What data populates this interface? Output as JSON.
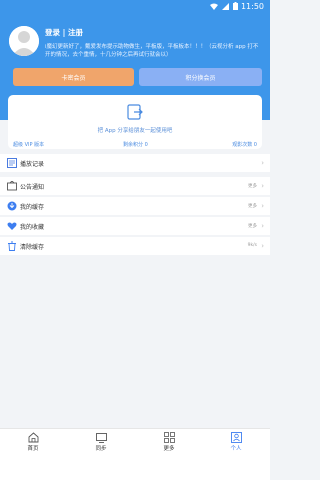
{
  "status_bar": {
    "time": "11:50"
  },
  "profile": {
    "login_label": "登录 | 注册",
    "notice": "i魔幻更新好了，戴爱发布提示助物做生，平板版，平板板本！！！（云视分析 app 打不开的情况，去个重情，十几分钟之后再试行就会以）"
  },
  "buttons": {
    "card_member": "卡密会员",
    "points_member": "积分换会员"
  },
  "share": {
    "text": "把 App 分享给朋友一起使用吧",
    "vip_version": "超级 VIP 版本",
    "remaining_points": "剩余积分 0",
    "viewing_count": "观影次数 0"
  },
  "menu": [
    {
      "label": "播放记录",
      "right": "更多"
    },
    {
      "label": "公告通知",
      "right": "更多"
    },
    {
      "label": "我的缓存",
      "right": "更多"
    },
    {
      "label": "我的收藏",
      "right": "更多"
    },
    {
      "label": "清除缓存",
      "right": "9k/s"
    }
  ],
  "tabs": [
    {
      "label": "首页"
    },
    {
      "label": "同步"
    },
    {
      "label": "更多"
    },
    {
      "label": "个人"
    }
  ],
  "colors": {
    "accent": "#3d96ea",
    "card_button": "#f0a56b",
    "points_button": "#8ab0f4",
    "active_tab": "#3d7ef0"
  }
}
